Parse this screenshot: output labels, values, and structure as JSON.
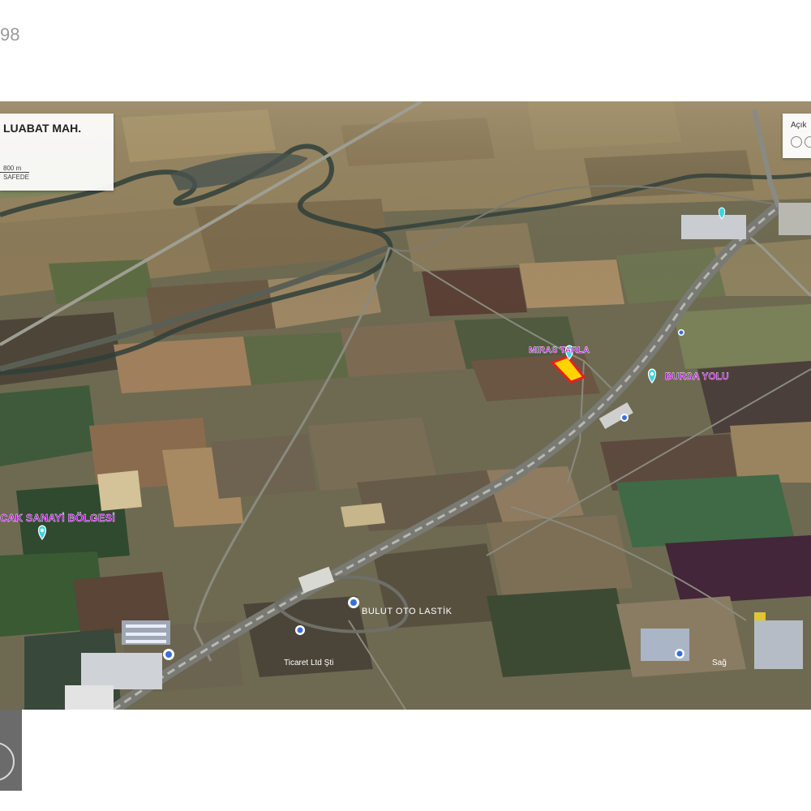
{
  "page": {
    "number_fragment": "98"
  },
  "info_box": {
    "title": "LUABAT MAH.",
    "distance": "800 m",
    "place_fragment": "SAFEDE"
  },
  "right_panel": {
    "label_fragment": "Açık"
  },
  "map_labels": {
    "parcel": "MIRAS TARLA",
    "road": "BURSA YOLU",
    "industrial_zone": "CAK SANAYİ BÖLGESİ",
    "tire_shop": "BULUT OTO LASTİK",
    "company": "Ticaret Ltd Şti",
    "site_bottom_right": "Sağ"
  },
  "colors": {
    "label_purple": "#b000d8",
    "pin_cyan": "#3fd4e0",
    "parcel_fill": "#ffd400",
    "parcel_outline": "#e81e1e"
  },
  "icons": [
    "location-pin-icon",
    "scale-bar-icon",
    "map-marker-icon"
  ]
}
